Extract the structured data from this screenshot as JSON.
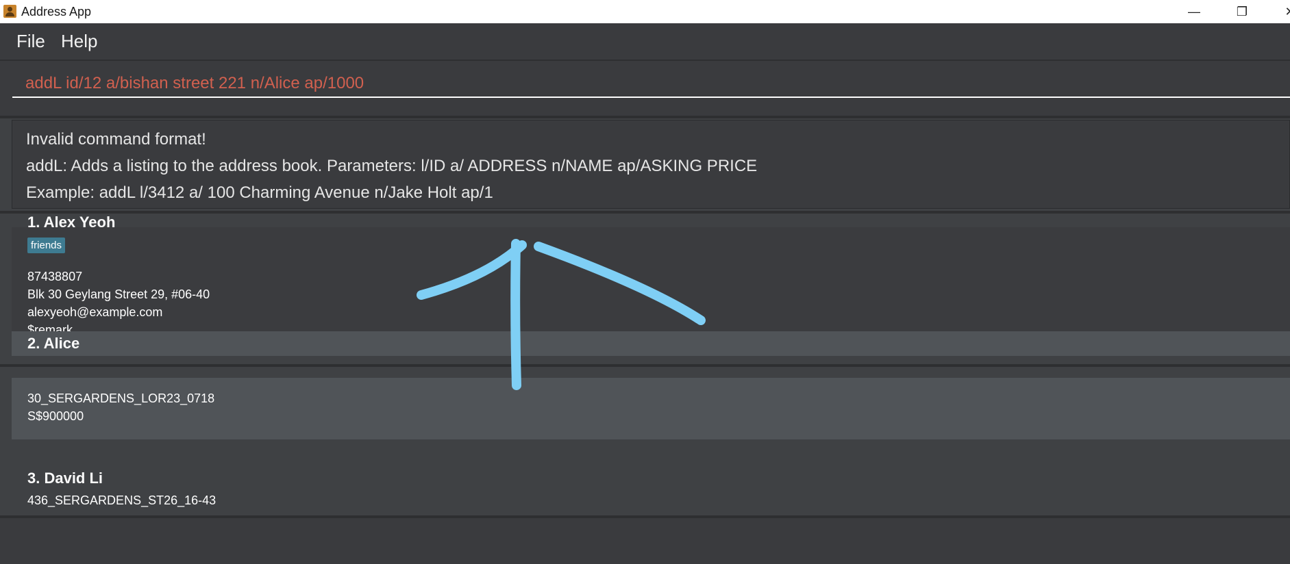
{
  "window": {
    "title": "Address App",
    "controls": {
      "minimize": "—",
      "restore": "❐",
      "close": "✕"
    }
  },
  "menu": {
    "file": "File",
    "help": "Help"
  },
  "command": {
    "value": "addL id/12 a/bishan street 221 n/Alice ap/1000",
    "color": "#d1604f"
  },
  "result": {
    "line1": "Invalid command format!",
    "line2": "addL: Adds a listing to the address book. Parameters: l/ID a/ ADDRESS n/NAME ap/ASKING PRICE",
    "line3": "Example: addL l/3412 a/ 100 Charming Avenue n/Jake Holt ap/1"
  },
  "persons": [
    {
      "name_partial": "1.  Alex Yeoh",
      "tag": "friends",
      "phone": "87438807",
      "address": "Blk 30 Geylang Street 29, #06-40",
      "email": "alexyeoh@example.com",
      "remark": "$remark"
    },
    {
      "name": "2.  Alice"
    }
  ],
  "listings": [
    {
      "id": "30_SERGARDENS_LOR23_0718",
      "price": "S$900000"
    },
    {
      "name": "3.  David Li",
      "id": "436_SERGARDENS_ST26_16-43"
    }
  ],
  "colors": {
    "background": "#3f4144",
    "tag": "#3e7b91",
    "annotation": "#7fcff5"
  }
}
